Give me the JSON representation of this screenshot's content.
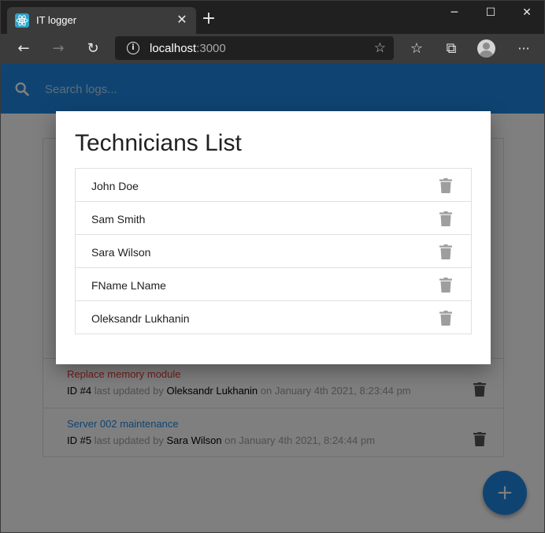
{
  "browser": {
    "tab_title": "IT logger",
    "tab_close": "✕",
    "new_tab": "+",
    "url_host": "localhost",
    "url_port": ":3000",
    "info_glyph": "i",
    "controls": {
      "minimize": "─",
      "maximize": "☐",
      "close": "✕"
    },
    "icons": {
      "back": "←",
      "forward": "→",
      "reload": "↻",
      "star": "☆",
      "favorites": "☆",
      "collections": "⧉",
      "more": "···"
    }
  },
  "app": {
    "search_placeholder": "Search logs...",
    "fab_label": "+",
    "logs": [
      {
        "message": "Replace memory module",
        "id_label": "ID #4",
        "mid_text": "last updated by",
        "tech": "Oleksandr Lukhanin",
        "date_text": "on January 4th 2021, 8:23:44 pm",
        "attention": true
      },
      {
        "message": "Server 002 maintenance",
        "id_label": "ID #5",
        "mid_text": "last updated by",
        "tech": "Sara Wilson",
        "date_text": "on January 4th 2021, 8:24:44 pm",
        "attention": false
      }
    ]
  },
  "modal": {
    "title": "Technicians List",
    "technicians": [
      "John Doe",
      "Sam Smith",
      "Sara Wilson",
      "FName LName",
      "Oleksandr Lukhanin"
    ]
  },
  "colors": {
    "primary": "#1e88e5",
    "attention": "#e53935",
    "link": "#1e88e5",
    "icon_gray": "#9e9e9e"
  }
}
